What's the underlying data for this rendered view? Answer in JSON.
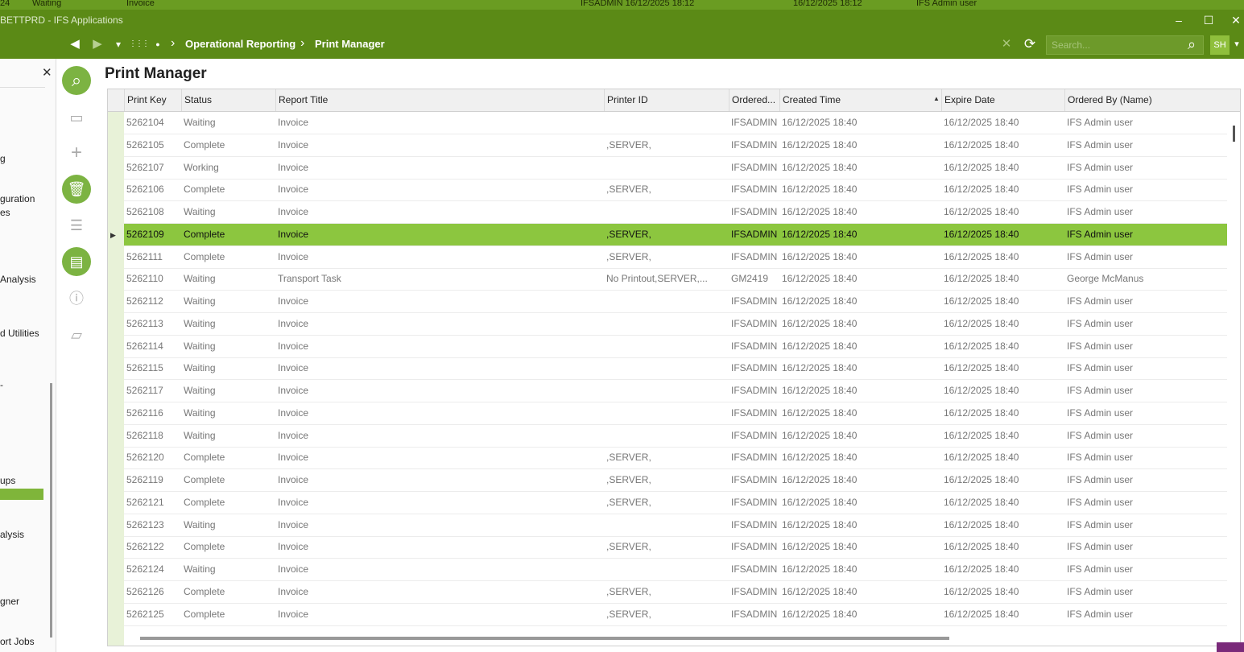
{
  "topstrip": {
    "frag1": "24",
    "frag2": "Waiting",
    "frag3": "Invoice",
    "frag4": "IFSADMIN  16/12/2025 18:12",
    "frag5": "16/12/2025 18:12",
    "frag6": "IFS Admin user"
  },
  "window": {
    "title": "BETTPRD - IFS Applications",
    "minimize": "–",
    "maximize": "☐",
    "close": "✕"
  },
  "nav": {
    "back": "◀",
    "forward": "▶",
    "dropdown": "▾",
    "apps": "⋮⋮⋮",
    "dot": "●",
    "sep": "›",
    "breadcrumb": [
      "Operational Reporting",
      "Print Manager"
    ],
    "clear": "✕",
    "refresh": "⟳",
    "search_placeholder": "Search...",
    "search_icon": "⌕",
    "avatar": "SH",
    "avatar_caret": "▾"
  },
  "leftpanel": {
    "close": "✕",
    "items": [
      "g",
      "guration",
      "es",
      "Analysis",
      "d Utilities",
      "-",
      "ups",
      "alysis",
      "gner",
      "ort Jobs"
    ]
  },
  "toolbar": {
    "search": "⌕",
    "save": "▭",
    "add": "+",
    "delete": "🗑",
    "list": "☰",
    "details": "▤",
    "info": "ⓘ",
    "note": "▱"
  },
  "page": {
    "title": "Print Manager"
  },
  "grid": {
    "columns": [
      "Print Key",
      "Status",
      "Report Title",
      "Printer ID",
      "Ordered...",
      "Created Time",
      "Expire Date",
      "Ordered By (Name)"
    ],
    "sort_indicator": "▲",
    "selected_marker": "▶",
    "selected_index": 5,
    "rows": [
      [
        "5262104",
        "Waiting",
        "Invoice",
        "",
        "IFSADMIN",
        "16/12/2025 18:40",
        "16/12/2025 18:40",
        "IFS Admin user"
      ],
      [
        "5262105",
        "Complete",
        "Invoice",
        ",SERVER,",
        "IFSADMIN",
        "16/12/2025 18:40",
        "16/12/2025 18:40",
        "IFS Admin user"
      ],
      [
        "5262107",
        "Working",
        "Invoice",
        "",
        "IFSADMIN",
        "16/12/2025 18:40",
        "16/12/2025 18:40",
        "IFS Admin user"
      ],
      [
        "5262106",
        "Complete",
        "Invoice",
        ",SERVER,",
        "IFSADMIN",
        "16/12/2025 18:40",
        "16/12/2025 18:40",
        "IFS Admin user"
      ],
      [
        "5262108",
        "Waiting",
        "Invoice",
        "",
        "IFSADMIN",
        "16/12/2025 18:40",
        "16/12/2025 18:40",
        "IFS Admin user"
      ],
      [
        "5262109",
        "Complete",
        "Invoice",
        ",SERVER,",
        "IFSADMIN",
        "16/12/2025 18:40",
        "16/12/2025 18:40",
        "IFS Admin user"
      ],
      [
        "5262111",
        "Complete",
        "Invoice",
        ",SERVER,",
        "IFSADMIN",
        "16/12/2025 18:40",
        "16/12/2025 18:40",
        "IFS Admin user"
      ],
      [
        "5262110",
        "Waiting",
        "Transport Task",
        "No Printout,SERVER,...",
        "GM2419",
        "16/12/2025 18:40",
        "16/12/2025 18:40",
        "George McManus"
      ],
      [
        "5262112",
        "Waiting",
        "Invoice",
        "",
        "IFSADMIN",
        "16/12/2025 18:40",
        "16/12/2025 18:40",
        "IFS Admin user"
      ],
      [
        "5262113",
        "Waiting",
        "Invoice",
        "",
        "IFSADMIN",
        "16/12/2025 18:40",
        "16/12/2025 18:40",
        "IFS Admin user"
      ],
      [
        "5262114",
        "Waiting",
        "Invoice",
        "",
        "IFSADMIN",
        "16/12/2025 18:40",
        "16/12/2025 18:40",
        "IFS Admin user"
      ],
      [
        "5262115",
        "Waiting",
        "Invoice",
        "",
        "IFSADMIN",
        "16/12/2025 18:40",
        "16/12/2025 18:40",
        "IFS Admin user"
      ],
      [
        "5262117",
        "Waiting",
        "Invoice",
        "",
        "IFSADMIN",
        "16/12/2025 18:40",
        "16/12/2025 18:40",
        "IFS Admin user"
      ],
      [
        "5262116",
        "Waiting",
        "Invoice",
        "",
        "IFSADMIN",
        "16/12/2025 18:40",
        "16/12/2025 18:40",
        "IFS Admin user"
      ],
      [
        "5262118",
        "Waiting",
        "Invoice",
        "",
        "IFSADMIN",
        "16/12/2025 18:40",
        "16/12/2025 18:40",
        "IFS Admin user"
      ],
      [
        "5262120",
        "Complete",
        "Invoice",
        ",SERVER,",
        "IFSADMIN",
        "16/12/2025 18:40",
        "16/12/2025 18:40",
        "IFS Admin user"
      ],
      [
        "5262119",
        "Complete",
        "Invoice",
        ",SERVER,",
        "IFSADMIN",
        "16/12/2025 18:40",
        "16/12/2025 18:40",
        "IFS Admin user"
      ],
      [
        "5262121",
        "Complete",
        "Invoice",
        ",SERVER,",
        "IFSADMIN",
        "16/12/2025 18:40",
        "16/12/2025 18:40",
        "IFS Admin user"
      ],
      [
        "5262123",
        "Waiting",
        "Invoice",
        "",
        "IFSADMIN",
        "16/12/2025 18:40",
        "16/12/2025 18:40",
        "IFS Admin user"
      ],
      [
        "5262122",
        "Complete",
        "Invoice",
        ",SERVER,",
        "IFSADMIN",
        "16/12/2025 18:40",
        "16/12/2025 18:40",
        "IFS Admin user"
      ],
      [
        "5262124",
        "Waiting",
        "Invoice",
        "",
        "IFSADMIN",
        "16/12/2025 18:40",
        "16/12/2025 18:40",
        "IFS Admin user"
      ],
      [
        "5262126",
        "Complete",
        "Invoice",
        ",SERVER,",
        "IFSADMIN",
        "16/12/2025 18:40",
        "16/12/2025 18:40",
        "IFS Admin user"
      ],
      [
        "5262125",
        "Complete",
        "Invoice",
        ",SERVER,",
        "IFSADMIN",
        "16/12/2025 18:40",
        "16/12/2025 18:40",
        "IFS Admin user"
      ]
    ]
  },
  "colors": {
    "brand_green": "#5b8a16",
    "selected_row": "#8cc63f",
    "accent_round": "#7cb342"
  }
}
